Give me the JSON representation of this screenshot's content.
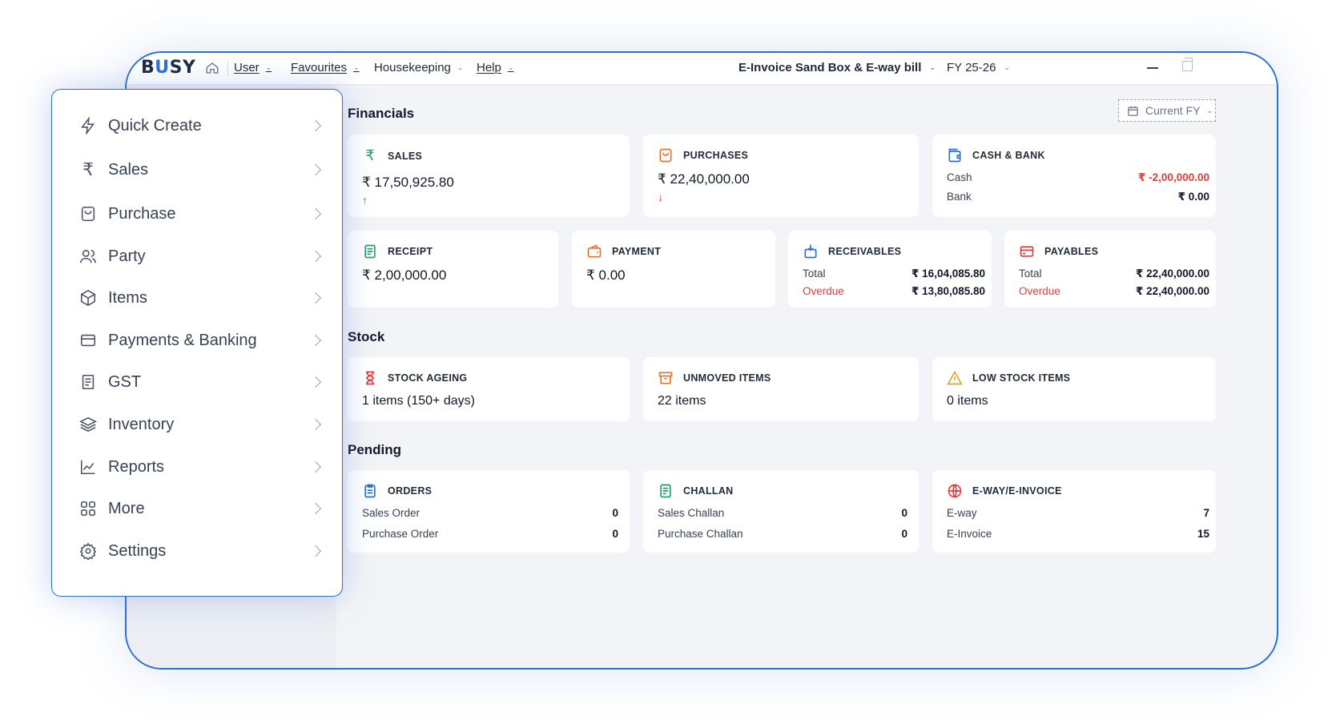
{
  "app": {
    "logo_left": "B",
    "logo_u": "U",
    "logo_right": "SY"
  },
  "topbar": {
    "menus": [
      {
        "label": "User"
      },
      {
        "label": "Favourites"
      },
      {
        "label": "Housekeeping"
      },
      {
        "label": "Help"
      }
    ],
    "company": "E-Invoice Sand Box & E-way bill",
    "fy": "FY 25-26"
  },
  "filter": {
    "label": "Current FY"
  },
  "sections": {
    "financials": "Financials",
    "stock": "Stock",
    "pending": "Pending"
  },
  "financials": {
    "sales": {
      "title": "SALES",
      "value": "₹ 17,50,925.80",
      "trend": "↑"
    },
    "purchases": {
      "title": "PURCHASES",
      "value": "₹ 22,40,000.00",
      "trend": "↓"
    },
    "cash_bank": {
      "title": "CASH & BANK",
      "rows": [
        {
          "label": "Cash",
          "value": "₹ -2,00,000.00"
        },
        {
          "label": "Bank",
          "value": "₹ 0.00"
        }
      ]
    },
    "receipt": {
      "title": "RECEIPT",
      "value": "₹ 2,00,000.00"
    },
    "payment": {
      "title": "PAYMENT",
      "value": "₹ 0.00"
    },
    "receivables": {
      "title": "RECEIVABLES",
      "rows": [
        {
          "label": "Total",
          "value": "₹ 16,04,085.80"
        },
        {
          "label": "Overdue",
          "value": "₹ 13,80,085.80"
        }
      ]
    },
    "payables": {
      "title": "PAYABLES",
      "rows": [
        {
          "label": "Total",
          "value": "₹ 22,40,000.00"
        },
        {
          "label": "Overdue",
          "value": "₹ 22,40,000.00"
        }
      ]
    }
  },
  "stock": {
    "ageing": {
      "title": "STOCK AGEING",
      "value": "1 items (150+ days)"
    },
    "unmoved": {
      "title": "UNMOVED ITEMS",
      "value": "22 items"
    },
    "low": {
      "title": "LOW STOCK ITEMS",
      "value": "0 items"
    }
  },
  "pending": {
    "orders": {
      "title": "ORDERS",
      "rows": [
        {
          "label": "Sales Order",
          "value": "0"
        },
        {
          "label": "Purchase Order",
          "value": "0"
        }
      ]
    },
    "challan": {
      "title": "CHALLAN",
      "rows": [
        {
          "label": "Sales Challan",
          "value": "0"
        },
        {
          "label": "Purchase Challan",
          "value": "0"
        }
      ]
    },
    "eway": {
      "title": "E-WAY/E-INVOICE",
      "rows": [
        {
          "label": "E-way",
          "value": "7"
        },
        {
          "label": "E-Invoice",
          "value": "15"
        }
      ]
    }
  },
  "sidebar": {
    "items": [
      {
        "label": "Quick Create",
        "icon": "lightning-icon"
      },
      {
        "label": "Sales",
        "icon": "rupee-icon"
      },
      {
        "label": "Purchase",
        "icon": "shopping-bag-icon"
      },
      {
        "label": "Party",
        "icon": "users-icon"
      },
      {
        "label": "Items",
        "icon": "box-icon"
      },
      {
        "label": "Payments & Banking",
        "icon": "credit-card-icon"
      },
      {
        "label": "GST",
        "icon": "receipt-icon"
      },
      {
        "label": "Inventory",
        "icon": "layers-icon"
      },
      {
        "label": "Reports",
        "icon": "line-chart-icon"
      },
      {
        "label": "More",
        "icon": "grid-icon"
      },
      {
        "label": "Settings",
        "icon": "gear-icon"
      }
    ]
  },
  "colors": {
    "accent": "#2a6fd6",
    "negative": "#e53935",
    "positive": "#22a06b",
    "orange": "#e8712c"
  }
}
